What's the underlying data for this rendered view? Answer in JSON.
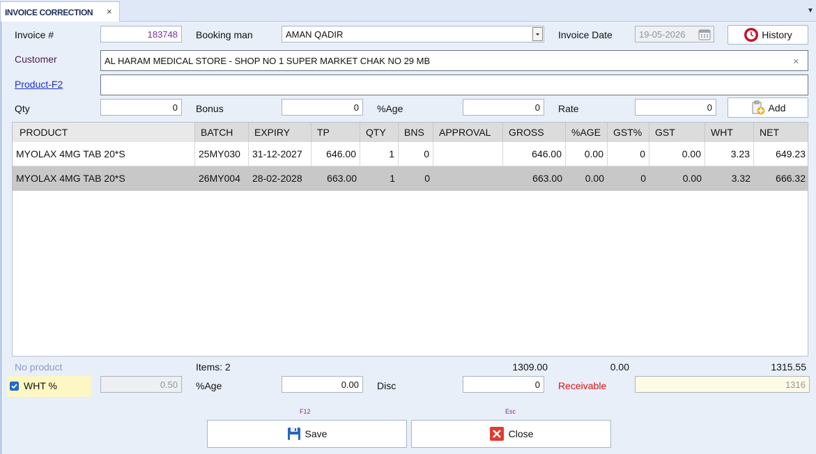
{
  "tab": {
    "title": "INVOICE CORRECTION",
    "close": "×",
    "menu": "▼"
  },
  "form": {
    "invoice_label": "Invoice #",
    "invoice_value": "183748",
    "booking_label": "Booking man",
    "booking_value": "AMAN QADIR",
    "invoice_date_label": "Invoice Date",
    "invoice_date_value": "19-05-2026",
    "history_label": "History",
    "customer_label": "Customer",
    "customer_value": "AL HARAM MEDICAL STORE - SHOP NO 1 SUPER MARKET CHAK NO 29 MB",
    "customer_clear": "×",
    "product_label": "Product-F2",
    "product_value": "",
    "qty_label": "Qty",
    "qty_value": "0",
    "bonus_label": "Bonus",
    "bonus_value": "0",
    "age_label": "%Age",
    "age_value": "0",
    "rate_label": "Rate",
    "rate_value": "0",
    "add_label": "Add"
  },
  "grid": {
    "columns": [
      "PRODUCT",
      "BATCH",
      "EXPIRY",
      "TP",
      "QTY",
      "BNS",
      "APPROVAL",
      "GROSS",
      "%AGE",
      "GST%",
      "GST",
      "WHT",
      "NET"
    ],
    "rows": [
      [
        "MYOLAX 4MG TAB 20*S",
        "25MY030",
        "31-12-2027",
        "646.00",
        "1",
        "0",
        "",
        "646.00",
        "0.00",
        "0",
        "0.00",
        "3.23",
        "649.23"
      ],
      [
        "MYOLAX 4MG TAB 20*S",
        "26MY004",
        "28-02-2028",
        "663.00",
        "1",
        "0",
        "",
        "663.00",
        "0.00",
        "0",
        "0.00",
        "3.32",
        "666.32"
      ]
    ]
  },
  "summary": {
    "no_product": "No product",
    "items": "Items: 2",
    "gross_total": "1309.00",
    "age_total": "0.00",
    "net_total": "1315.55"
  },
  "footer": {
    "wht_label": "WHT %",
    "wht_checked": true,
    "wht_value": "0.50",
    "age_label": "%Age",
    "age_value": "0.00",
    "disc_label": "Disc",
    "disc_value": "0",
    "receivable_label": "Receivable",
    "receivable_value": "1316"
  },
  "actions": {
    "save_key": "F12",
    "save_label": "Save",
    "close_key": "Esc",
    "close_label": "Close"
  },
  "colors": {
    "invoice_number": "#7b2fa8",
    "receivable": "#e01010",
    "no_product": "#8e9ac6",
    "wht_highlight": "#fdf7c3",
    "receivable_field": "#fdfbe4"
  }
}
